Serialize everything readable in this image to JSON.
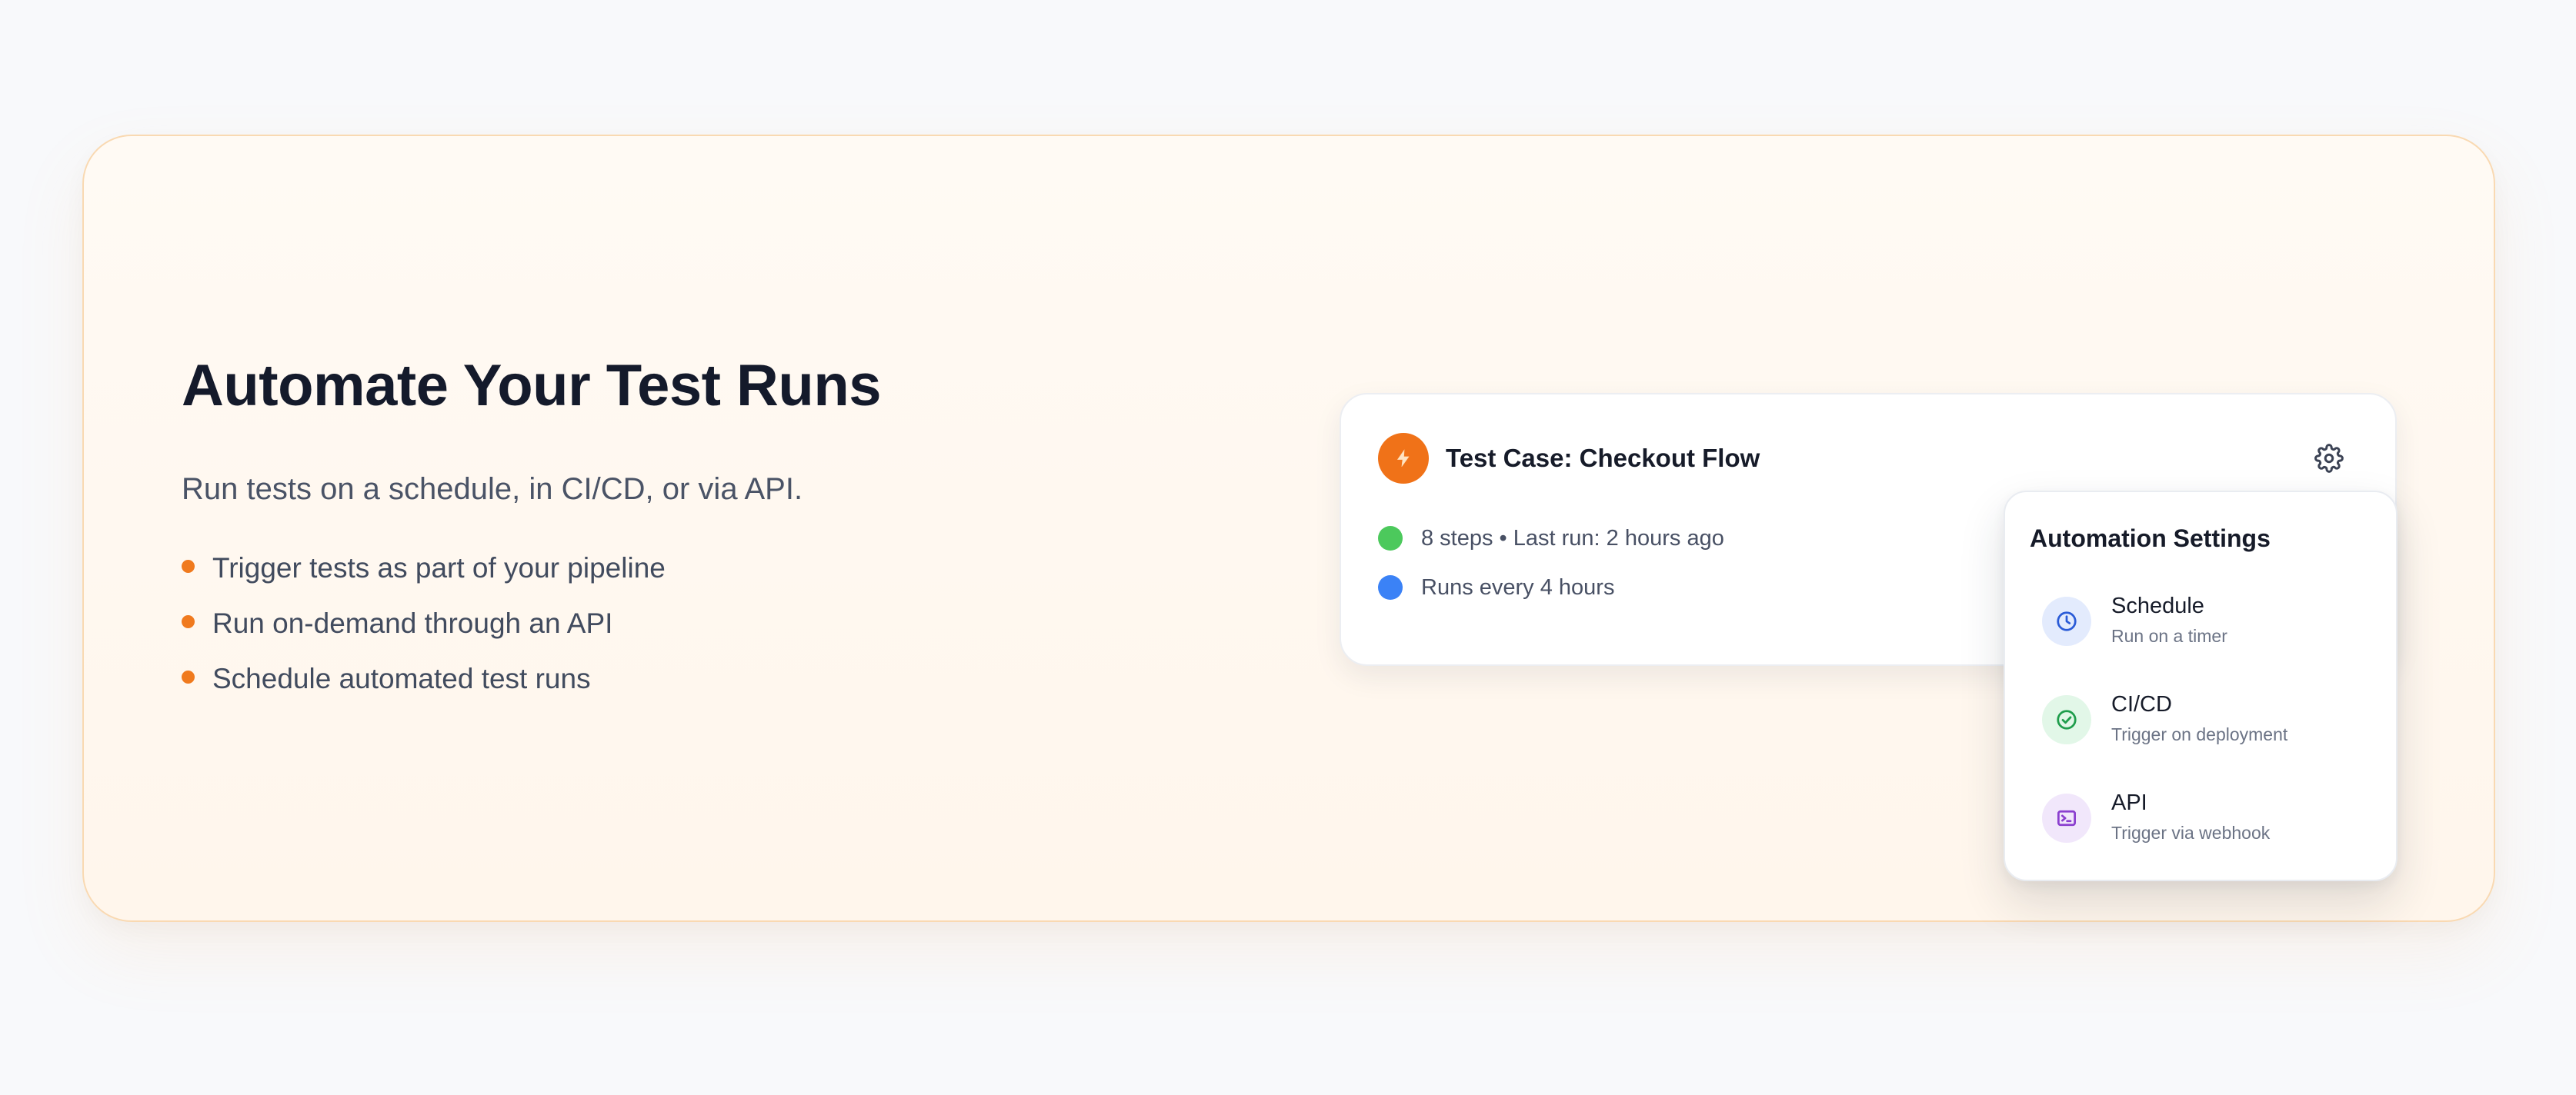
{
  "hero": {
    "headline": "Automate Your Test Runs",
    "subhead": "Run tests on a schedule, in CI/CD, or via API.",
    "bullets": [
      "Trigger tests as part of your pipeline",
      "Run on-demand through an API",
      "Schedule automated test runs"
    ],
    "accent_color": "#f07a1e"
  },
  "card": {
    "icon": "lightning-bolt-icon",
    "title": "Test Case: Checkout Flow",
    "settings_icon": "gear-icon",
    "meta": [
      {
        "text": "8 steps • Last run: 2 hours ago",
        "dot_color": "#4cc95c"
      },
      {
        "text": "Runs every 4 hours",
        "dot_color": "#3b82f6"
      }
    ]
  },
  "dropdown": {
    "title": "Automation Settings",
    "items": [
      {
        "label": "Schedule",
        "description": "Run on a timer",
        "icon": "clock-icon",
        "icon_color": "#2a5bd7",
        "icon_bg": "#e3ebfd"
      },
      {
        "label": "CI/CD",
        "description": "Trigger on deployment",
        "icon": "check-circle-icon",
        "icon_color": "#1f9d4c",
        "icon_bg": "#e2f7e8"
      },
      {
        "label": "API",
        "description": "Trigger via webhook",
        "icon": "terminal-icon",
        "icon_color": "#8b3fcf",
        "icon_bg": "#f1e7fb"
      }
    ]
  }
}
